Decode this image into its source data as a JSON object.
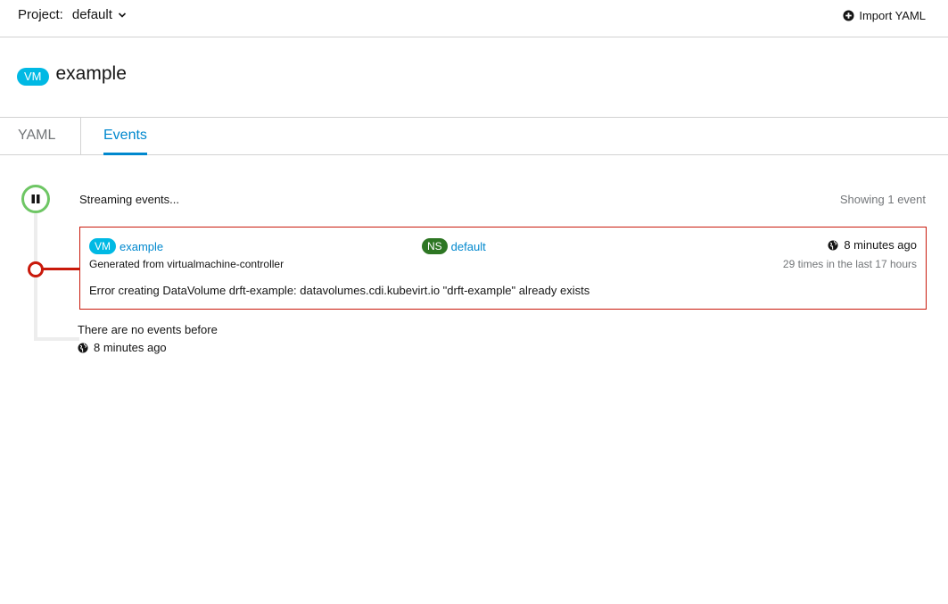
{
  "topbar": {
    "project_label": "Project:",
    "project_value": "default",
    "import_label": "Import YAML"
  },
  "header": {
    "kind_badge": "VM",
    "name": "example"
  },
  "tabs": [
    {
      "label": "YAML",
      "active": false
    },
    {
      "label": "Events",
      "active": true
    }
  ],
  "events": {
    "streaming_text": "Streaming events...",
    "showing_text": "Showing 1 event",
    "items": [
      {
        "source_badge": "VM",
        "source_name": "example",
        "namespace_badge": "NS",
        "namespace_name": "default",
        "time": "8 minutes ago",
        "generated_from": "Generated from virtualmachine-controller",
        "count_text": "29 times in the last 17 hours",
        "message": "Error creating DataVolume drft-example: datavolumes.cdi.kubevirt.io \"drft-example\" already exists",
        "status": "error"
      }
    ],
    "no_events_text": "There are no events before",
    "no_events_time": "8 minutes ago"
  },
  "colors": {
    "accent": "#0088ce",
    "vm_badge": "#00b9e4",
    "ns_badge": "#2d7623",
    "error": "#c9190b",
    "streaming": "#6ec664"
  },
  "icons": {
    "project_dropdown": "chevron-down-icon",
    "import": "plus-circle-icon",
    "stream_toggle": "pause-icon",
    "time": "globe-icon"
  }
}
